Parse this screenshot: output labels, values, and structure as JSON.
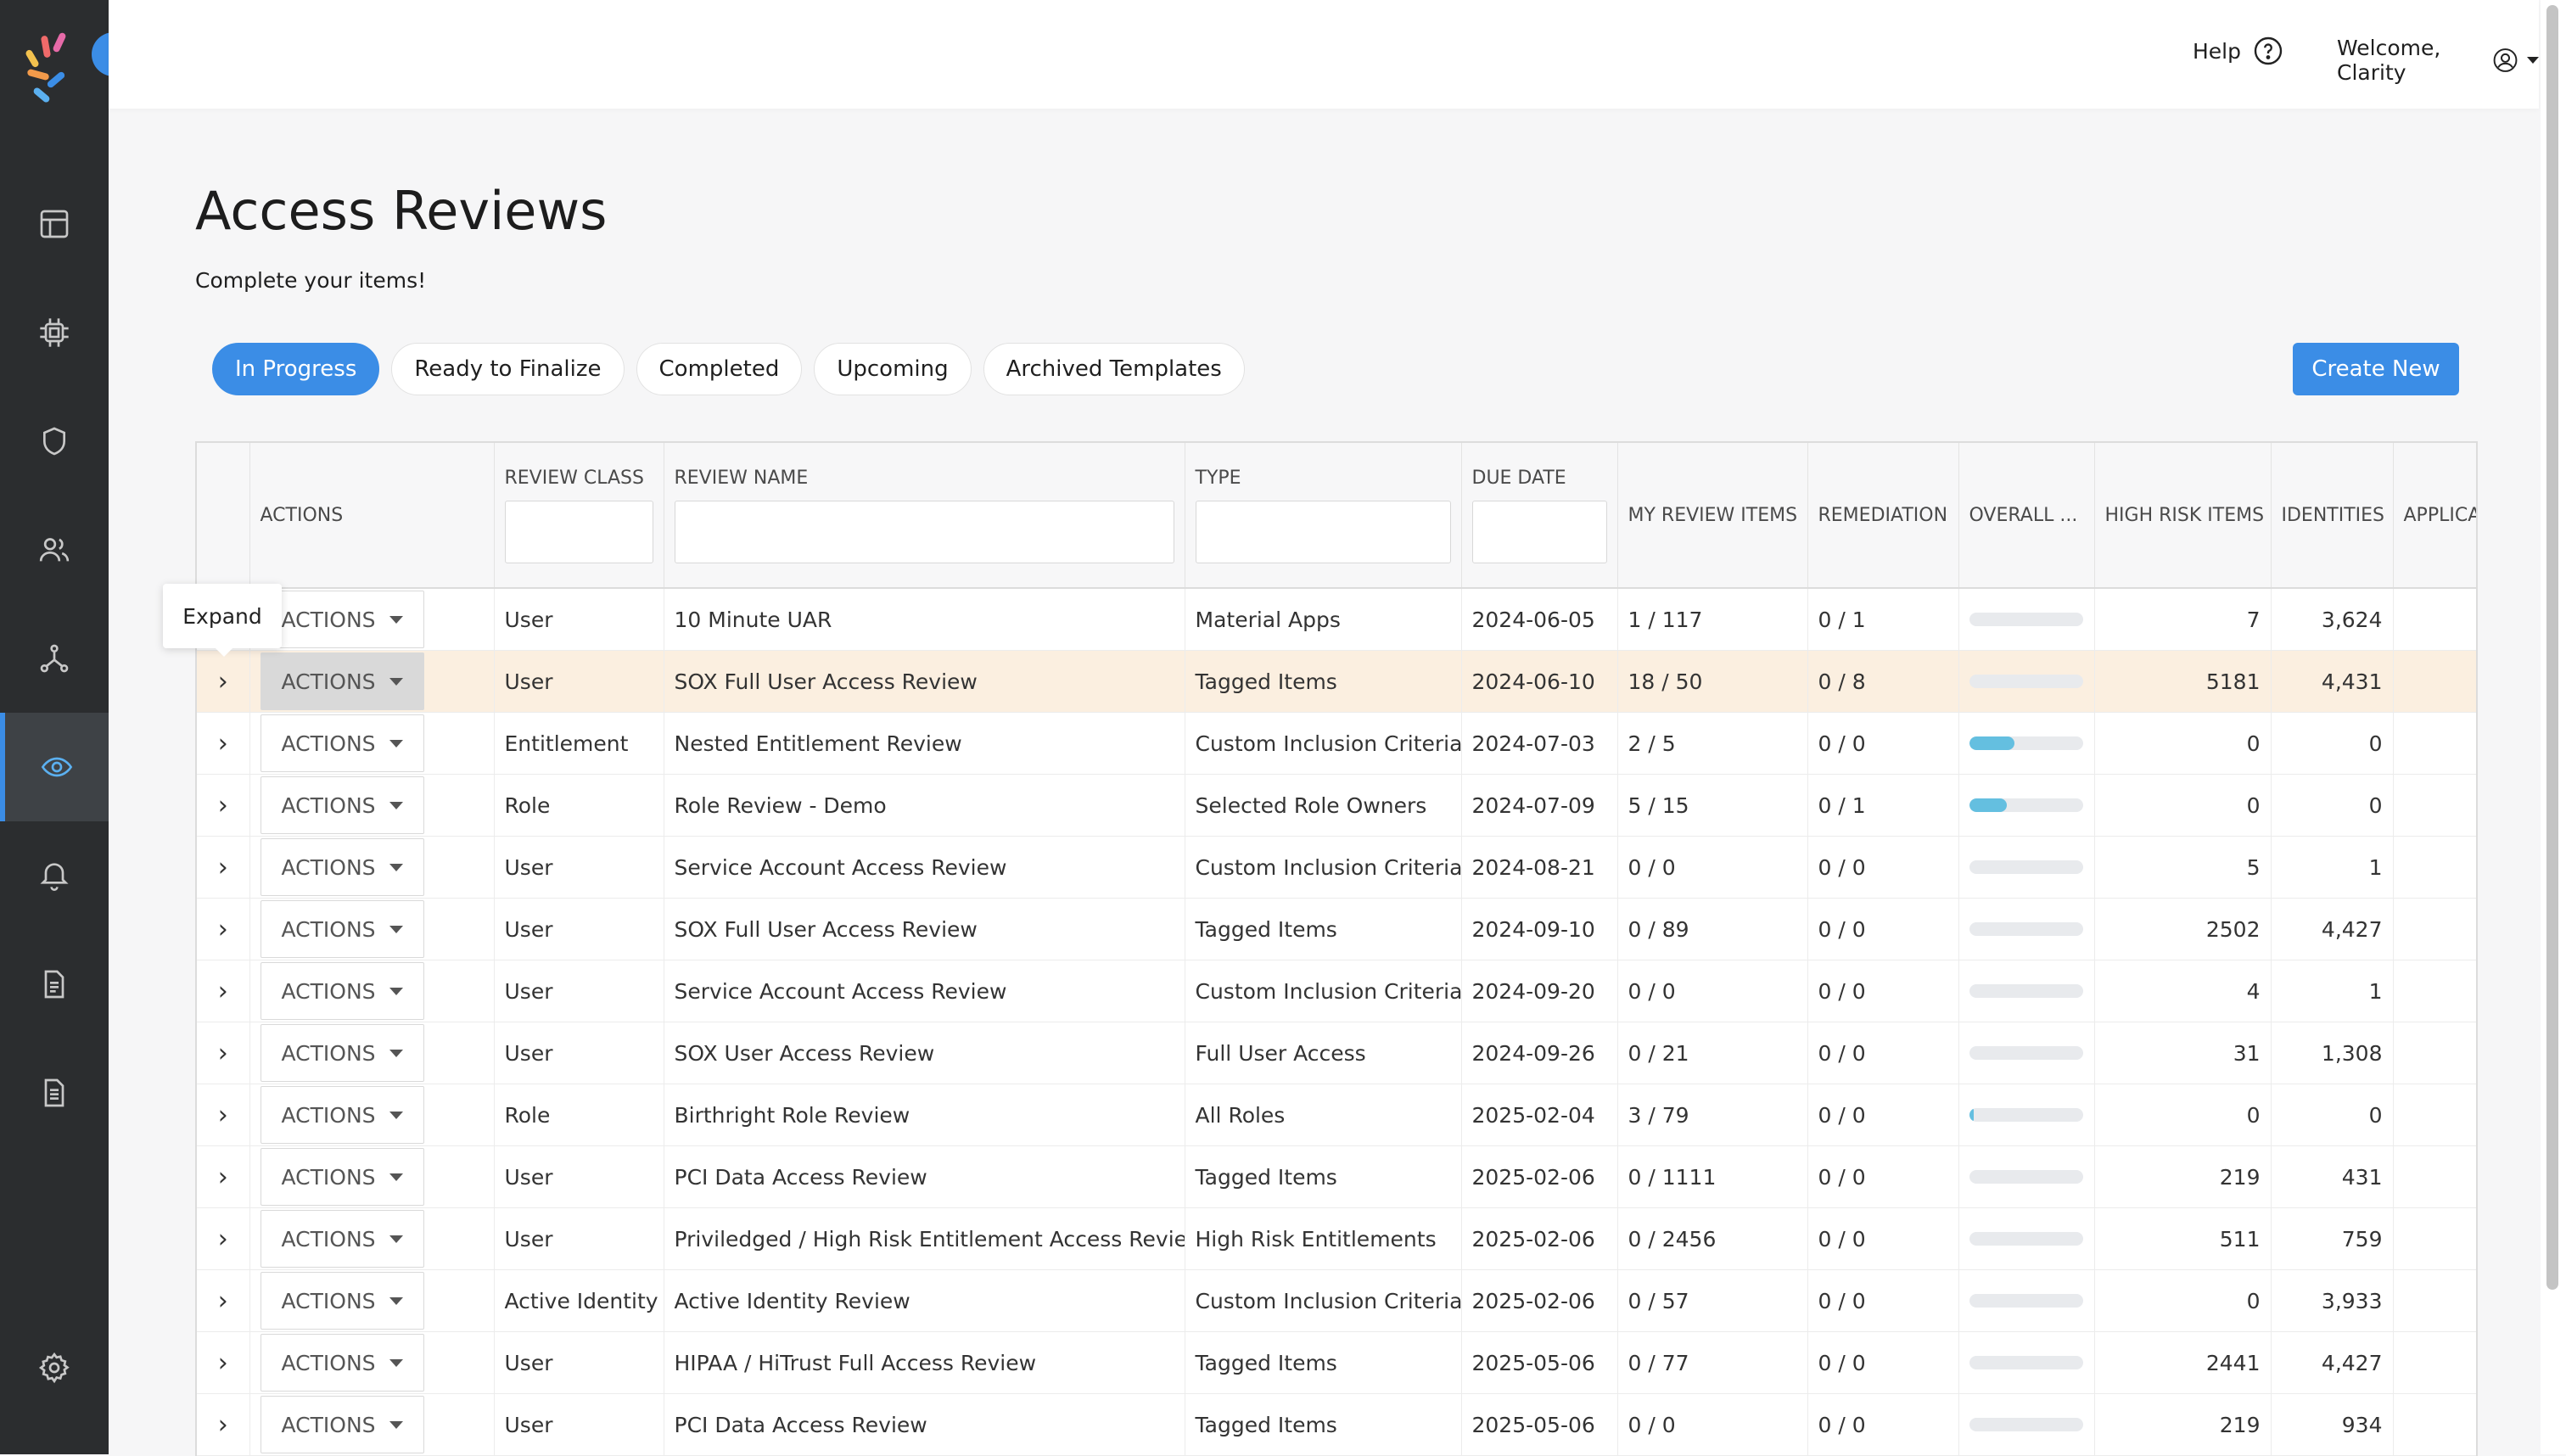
{
  "app": {
    "brand_colors": {
      "accent": "#3b8de6",
      "sidebar": "#2b2d2f",
      "highlight_row": "#fbefe0",
      "progress": "#64bfe0"
    }
  },
  "sidebar": {
    "items": [
      {
        "icon": "layout-icon"
      },
      {
        "icon": "chip-icon"
      },
      {
        "icon": "shield-icon"
      },
      {
        "icon": "users-icon"
      },
      {
        "icon": "network-icon"
      },
      {
        "icon": "eye-icon",
        "active": true
      },
      {
        "icon": "bell-icon"
      },
      {
        "icon": "document-icon"
      },
      {
        "icon": "report-icon"
      }
    ],
    "settings_icon": "gear-icon"
  },
  "header": {
    "help_label": "Help",
    "welcome_label": "Welcome, Clarity"
  },
  "page": {
    "title": "Access Reviews",
    "subtitle": "Complete your items!"
  },
  "tabs": [
    {
      "label": "In Progress",
      "active": true
    },
    {
      "label": "Ready to Finalize"
    },
    {
      "label": "Completed"
    },
    {
      "label": "Upcoming"
    },
    {
      "label": "Archived Templates"
    }
  ],
  "create_label": "Create New",
  "tooltip": "Expand",
  "table": {
    "columns": [
      "ACTIONS",
      "REVIEW CLASS",
      "REVIEW NAME",
      "TYPE",
      "DUE DATE",
      "MY REVIEW ITEMS",
      "REMEDIATION",
      "OVERALL ...",
      "HIGH RISK ITEMS",
      "IDENTITIES",
      "APPLICA"
    ],
    "action_label": "ACTIONS",
    "rows": [
      {
        "review_class": "User",
        "review_name": "10 Minute UAR",
        "type": "Material Apps",
        "due_date": "2024-06-05",
        "my_items": "1 / 117",
        "remediation": "0 / 1",
        "progress": 0,
        "high_risk": "7",
        "identities": "3,624"
      },
      {
        "review_class": "User",
        "review_name": "SOX Full User Access Review",
        "type": "Tagged Items",
        "due_date": "2024-06-10",
        "my_items": "18 / 50",
        "remediation": "0 / 8",
        "progress": 0,
        "high_risk": "5181",
        "identities": "4,431",
        "highlight": true
      },
      {
        "review_class": "Entitlement",
        "review_name": "Nested Entitlement Review",
        "type": "Custom Inclusion Criteria",
        "due_date": "2024-07-03",
        "my_items": "2 / 5",
        "remediation": "0 / 0",
        "progress": 40,
        "high_risk": "0",
        "identities": "0"
      },
      {
        "review_class": "Role",
        "review_name": "Role Review - Demo",
        "type": "Selected Role Owners",
        "due_date": "2024-07-09",
        "my_items": "5 / 15",
        "remediation": "0 / 1",
        "progress": 33,
        "high_risk": "0",
        "identities": "0"
      },
      {
        "review_class": "User",
        "review_name": "Service Account Access Review",
        "type": "Custom Inclusion Criteria",
        "due_date": "2024-08-21",
        "my_items": "0 / 0",
        "remediation": "0 / 0",
        "progress": 0,
        "high_risk": "5",
        "identities": "1"
      },
      {
        "review_class": "User",
        "review_name": "SOX Full User Access Review",
        "type": "Tagged Items",
        "due_date": "2024-09-10",
        "my_items": "0 / 89",
        "remediation": "0 / 0",
        "progress": 0,
        "high_risk": "2502",
        "identities": "4,427"
      },
      {
        "review_class": "User",
        "review_name": "Service Account Access Review",
        "type": "Custom Inclusion Criteria",
        "due_date": "2024-09-20",
        "my_items": "0 / 0",
        "remediation": "0 / 0",
        "progress": 0,
        "high_risk": "4",
        "identities": "1"
      },
      {
        "review_class": "User",
        "review_name": "SOX User Access Review",
        "type": "Full User Access",
        "due_date": "2024-09-26",
        "my_items": "0 / 21",
        "remediation": "0 / 0",
        "progress": 0,
        "high_risk": "31",
        "identities": "1,308"
      },
      {
        "review_class": "Role",
        "review_name": "Birthright Role Review",
        "type": "All Roles",
        "due_date": "2025-02-04",
        "my_items": "3 / 79",
        "remediation": "0 / 0",
        "progress": 4,
        "high_risk": "0",
        "identities": "0"
      },
      {
        "review_class": "User",
        "review_name": "PCI Data Access Review",
        "type": "Tagged Items",
        "due_date": "2025-02-06",
        "my_items": "0 / 1111",
        "remediation": "0 / 0",
        "progress": 0,
        "high_risk": "219",
        "identities": "431"
      },
      {
        "review_class": "User",
        "review_name": "Priviledged / High Risk Entitlement Access Review",
        "type": "High Risk Entitlements",
        "due_date": "2025-02-06",
        "my_items": "0 / 2456",
        "remediation": "0 / 0",
        "progress": 0,
        "high_risk": "511",
        "identities": "759"
      },
      {
        "review_class": "Active Identity",
        "review_name": "Active Identity Review",
        "type": "Custom Inclusion Criteria",
        "due_date": "2025-02-06",
        "my_items": "0 / 57",
        "remediation": "0 / 0",
        "progress": 0,
        "high_risk": "0",
        "identities": "3,933"
      },
      {
        "review_class": "User",
        "review_name": "HIPAA / HiTrust Full Access Review",
        "type": "Tagged Items",
        "due_date": "2025-05-06",
        "my_items": "0 / 77",
        "remediation": "0 / 0",
        "progress": 0,
        "high_risk": "2441",
        "identities": "4,427"
      },
      {
        "review_class": "User",
        "review_name": "PCI Data Access Review",
        "type": "Tagged Items",
        "due_date": "2025-05-06",
        "my_items": "0 / 0",
        "remediation": "0 / 0",
        "progress": 0,
        "high_risk": "219",
        "identities": "934"
      }
    ]
  }
}
